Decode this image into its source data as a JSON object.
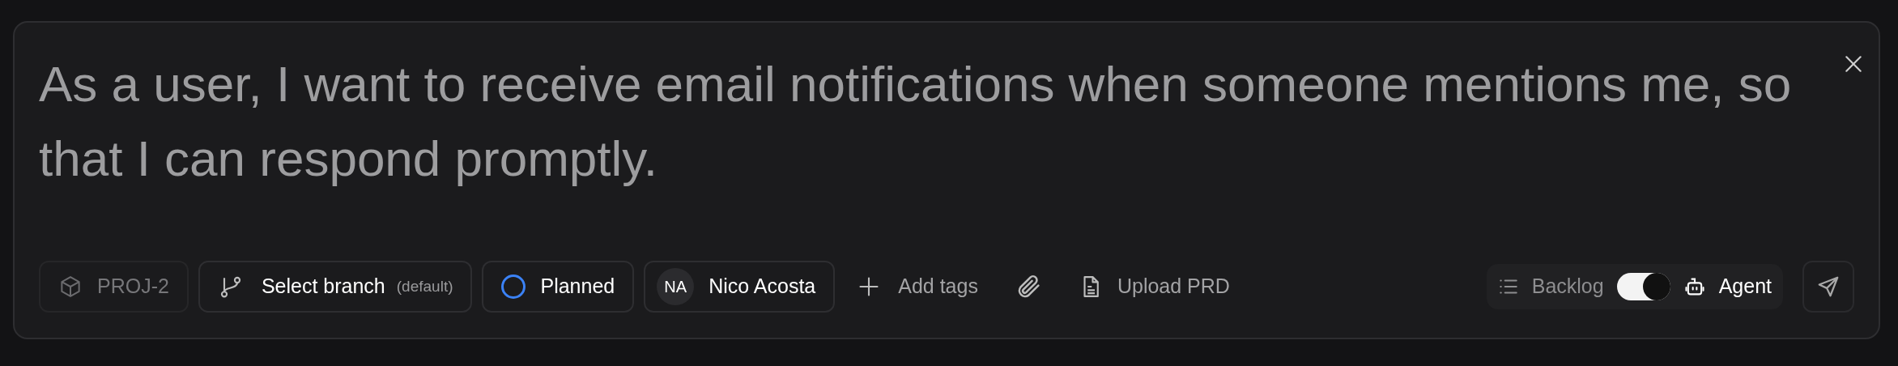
{
  "composer": {
    "text": "As a user, I want to receive email notifications when someone mentions me, so that I can respond promptly.",
    "project": {
      "label": "PROJ-2",
      "disabled": true
    },
    "branch": {
      "label": "Select branch",
      "hint": "(default)"
    },
    "status": {
      "label": "Planned",
      "color": "#3b82f6"
    },
    "assignee": {
      "initials": "NA",
      "name": "Nico Acosta"
    },
    "add_tags": "Add tags",
    "upload": "Upload PRD",
    "modes": [
      {
        "label": "Backlog",
        "selected": false
      },
      {
        "label": "Agent",
        "selected": true
      }
    ]
  }
}
